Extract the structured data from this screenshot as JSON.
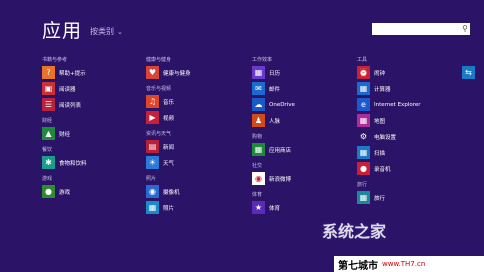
{
  "page": {
    "title": "应用",
    "sort_label": "按类别",
    "search_placeholder": ""
  },
  "columns": [
    {
      "groups": [
        {
          "header": "书籍与参考",
          "apps": [
            {
              "name": "帮助+提示",
              "icon": "help-icon",
              "color": "#e8732a"
            },
            {
              "name": "阅读器",
              "icon": "reader-icon",
              "color": "#c8303a"
            },
            {
              "name": "阅读列表",
              "icon": "reading-list-icon",
              "color": "#b8233c"
            }
          ]
        },
        {
          "header": "财经",
          "apps": [
            {
              "name": "财经",
              "icon": "finance-icon",
              "color": "#1e8a3a"
            }
          ]
        },
        {
          "header": "餐饮",
          "apps": [
            {
              "name": "食物和饮料",
              "icon": "food-icon",
              "color": "#1a9e8a"
            }
          ]
        },
        {
          "header": "游戏",
          "apps": [
            {
              "name": "游戏",
              "icon": "games-icon",
              "color": "#2e8b2e"
            }
          ]
        }
      ]
    },
    {
      "groups": [
        {
          "header": "健康与健身",
          "apps": [
            {
              "name": "健康与健身",
              "icon": "health-icon",
              "color": "#d8443a"
            }
          ]
        },
        {
          "header": "音乐与视频",
          "apps": [
            {
              "name": "音乐",
              "icon": "music-icon",
              "color": "#e0452a"
            },
            {
              "name": "视频",
              "icon": "video-icon",
              "color": "#c8203a"
            }
          ]
        },
        {
          "header": "资讯与天气",
          "apps": [
            {
              "name": "新闻",
              "icon": "news-icon",
              "color": "#b8203a"
            },
            {
              "name": "天气",
              "icon": "weather-icon",
              "color": "#2a7ad8"
            }
          ]
        },
        {
          "header": "照片",
          "apps": [
            {
              "name": "摄像机",
              "icon": "camera-icon",
              "color": "#2a6ad0"
            },
            {
              "name": "照片",
              "icon": "photos-icon",
              "color": "#1a8ac8"
            }
          ]
        }
      ]
    },
    {
      "groups": [
        {
          "header": "工作效率",
          "apps": [
            {
              "name": "日历",
              "icon": "calendar-icon",
              "color": "#6a3ac8"
            },
            {
              "name": "邮件",
              "icon": "mail-icon",
              "color": "#1a6ad0"
            },
            {
              "name": "OneDrive",
              "icon": "onedrive-icon",
              "color": "#1a5ac8"
            },
            {
              "name": "人脉",
              "icon": "people-icon",
              "color": "#d04a1a"
            }
          ]
        },
        {
          "header": "购物",
          "apps": [
            {
              "name": "应用商店",
              "icon": "store-icon",
              "color": "#1e8a3a"
            }
          ]
        },
        {
          "header": "社交",
          "apps": [
            {
              "name": "新浪微博",
              "icon": "weibo-icon",
              "color": "#ffffff"
            }
          ]
        },
        {
          "header": "体育",
          "apps": [
            {
              "name": "体育",
              "icon": "sports-icon",
              "color": "#5a2ab8"
            }
          ]
        }
      ]
    },
    {
      "groups": [
        {
          "header": "工具",
          "apps": [
            {
              "name": "闹钟",
              "icon": "alarm-icon",
              "color": "#c8203a"
            },
            {
              "name": "计算器",
              "icon": "calculator-icon",
              "color": "#1a6ad0"
            },
            {
              "name": "Internet Explorer",
              "icon": "ie-icon",
              "color": "#1a5ad0"
            },
            {
              "name": "地图",
              "icon": "maps-icon",
              "color": "#b02a9a"
            },
            {
              "name": "电脑设置",
              "icon": "settings-icon",
              "color": "#2b1468"
            },
            {
              "name": "扫描",
              "icon": "scan-icon",
              "color": "#1a7ac8"
            },
            {
              "name": "录音机",
              "icon": "recorder-icon",
              "color": "#c8203a"
            }
          ]
        },
        {
          "header": "旅行",
          "apps": [
            {
              "name": "旅行",
              "icon": "travel-icon",
              "color": "#1a8a9a"
            }
          ]
        }
      ]
    },
    {
      "groups": [
        {
          "header": "其他",
          "apps": [
            {
              "name": "",
              "icon": "app-icon",
              "color": "#1a7ac8"
            }
          ]
        }
      ]
    }
  ],
  "watermark": {
    "brand": "系统之家",
    "footer_text": "第七城市",
    "footer_url": "www.TH7.cn"
  }
}
